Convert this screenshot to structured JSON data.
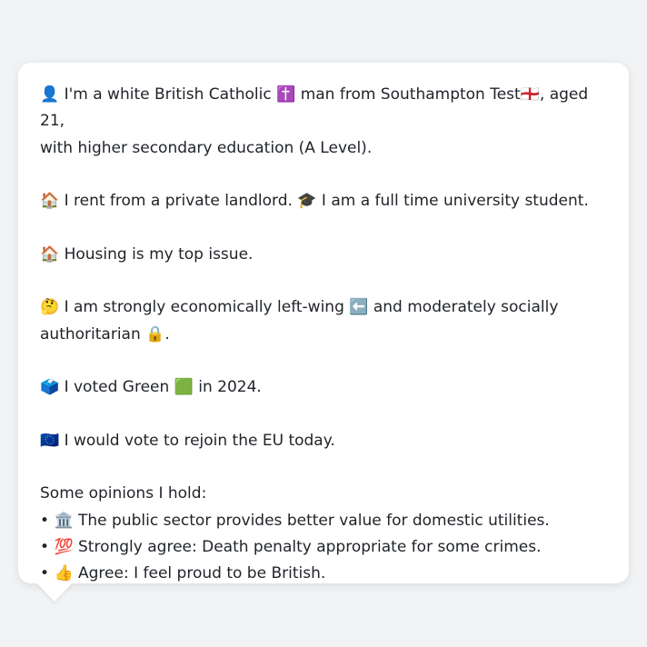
{
  "profile": {
    "p1": {
      "icon": "👤",
      "text_a": "I'm a white British Catholic",
      "icon_religion": "✝️",
      "text_b": "man from Southampton Test",
      "icon_flag": "🏴󠁧󠁢󠁥󠁮󠁧󠁿",
      "text_c": ", aged 21,",
      "text_d": "with higher secondary education (A Level)."
    },
    "p2": {
      "icon_house": "🏠",
      "text_a": "I rent from a private landlord.",
      "icon_cap": "🎓",
      "text_b": "I am a full time university student."
    },
    "p3": {
      "icon": "🏠",
      "text": "Housing is my top issue."
    },
    "p4": {
      "icon": "🤔",
      "text_a": "I am strongly economically left-wing",
      "icon_left": "⬅️",
      "text_b": "and moderately socially",
      "text_c": "authoritarian",
      "icon_lock": "🔒",
      "text_d": "."
    },
    "p5": {
      "icon": "🗳️",
      "text_a": "I voted Green",
      "icon_green": "🟩",
      "text_b": "in 2024."
    },
    "p6": {
      "icon": "🇪🇺",
      "text": "I would vote to rejoin the EU today."
    },
    "opinions": {
      "heading": "Some opinions I hold:",
      "bullet": "•",
      "items": [
        {
          "icon": "🏛️",
          "text": "The public sector provides better value for domestic utilities."
        },
        {
          "icon": "💯",
          "text": "Strongly agree: Death penalty appropriate for some crimes."
        },
        {
          "icon": "👍",
          "text": "Agree: I feel proud to be British."
        }
      ]
    }
  }
}
